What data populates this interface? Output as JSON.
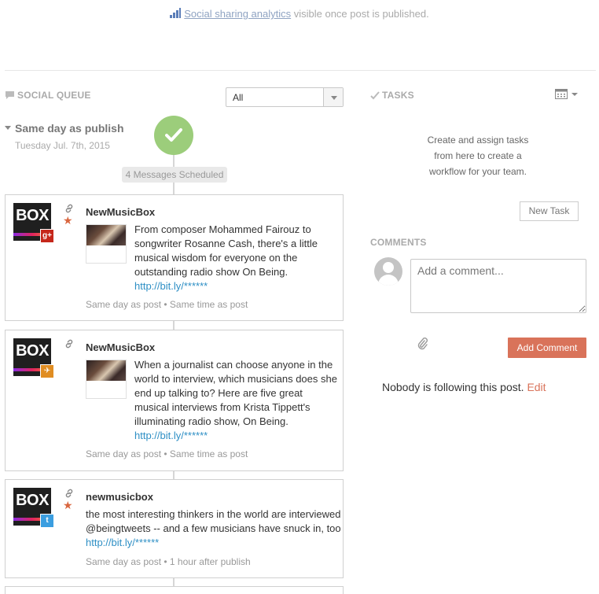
{
  "top_note": {
    "link_text": "Social sharing analytics",
    "suffix": " visible once post is published."
  },
  "social_queue": {
    "heading": "SOCIAL QUEUE",
    "filter": {
      "selected": "All"
    },
    "group": {
      "title": "Same day as publish",
      "date": "Tuesday Jul. 7th, 2015"
    },
    "scheduled_label": "4 Messages Scheduled",
    "posts": [
      {
        "account": "NewMusicBox",
        "network": "google-plus",
        "badge": "g+",
        "starred": true,
        "has_thumb": true,
        "text": "From composer Mohammed Fairouz to songwriter Rosanne Cash, there's a little musical wisdom for everyone on the outstanding radio show On Being.",
        "url": "http://bit.ly/******",
        "timing": "Same day as post • Same time as post"
      },
      {
        "account": "NewMusicBox",
        "network": "rss",
        "badge": "✈",
        "starred": false,
        "has_thumb": true,
        "text": "When a journalist can choose anyone in the world to interview, which musicians does she end up talking to? Here are five great musical interviews from Krista Tippett's illuminating radio show, On Being.",
        "url": "http://bit.ly/******",
        "timing": "Same day as post • Same time as post"
      },
      {
        "account": "newmusicbox",
        "network": "twitter",
        "badge": "t",
        "starred": true,
        "has_thumb": false,
        "text": "the most interesting thinkers in the world are interviewed @beingtweets -- and a few musicians have snuck in, too",
        "url": "http://bit.ly/******",
        "timing": "Same day as post • 1 hour after publish"
      }
    ]
  },
  "tasks": {
    "heading": "TASKS",
    "help_text": "Create and assign tasks from here to create a workflow for your team.",
    "new_task_label": "New Task"
  },
  "comments": {
    "heading": "COMMENTS",
    "placeholder": "Add a comment...",
    "add_label": "Add Comment",
    "following_text": "Nobody is following this post.",
    "edit_label": "Edit"
  },
  "colors": {
    "accent": "#d9735a",
    "check": "#9ccd7b",
    "link": "#2e8fc5"
  }
}
